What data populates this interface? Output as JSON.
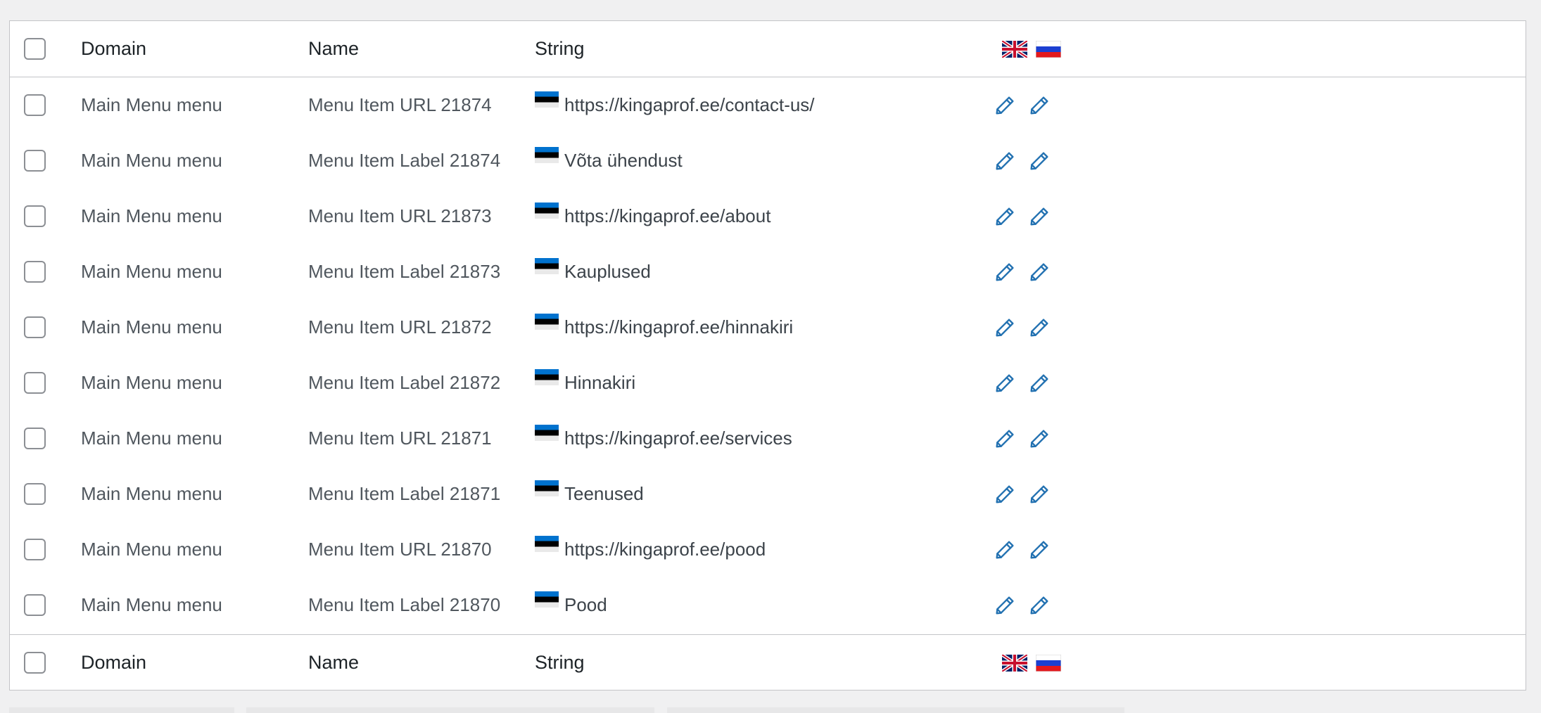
{
  "columns": {
    "domain": "Domain",
    "name": "Name",
    "string": "String"
  },
  "language_flags": [
    "uk-flag-icon",
    "ru-flag-icon"
  ],
  "string_flag": "ee-flag-icon",
  "rows": [
    {
      "domain": "Main Menu menu",
      "name": "Menu Item URL 21874",
      "string": "https://kingaprof.ee/contact-us/"
    },
    {
      "domain": "Main Menu menu",
      "name": "Menu Item Label 21874",
      "string": "Võta ühendust"
    },
    {
      "domain": "Main Menu menu",
      "name": "Menu Item URL 21873",
      "string": "https://kingaprof.ee/about"
    },
    {
      "domain": "Main Menu menu",
      "name": "Menu Item Label 21873",
      "string": "Kauplused"
    },
    {
      "domain": "Main Menu menu",
      "name": "Menu Item URL 21872",
      "string": "https://kingaprof.ee/hinnakiri"
    },
    {
      "domain": "Main Menu menu",
      "name": "Menu Item Label 21872",
      "string": "Hinnakiri"
    },
    {
      "domain": "Main Menu menu",
      "name": "Menu Item URL 21871",
      "string": "https://kingaprof.ee/services"
    },
    {
      "domain": "Main Menu menu",
      "name": "Menu Item Label 21871",
      "string": "Teenused"
    },
    {
      "domain": "Main Menu menu",
      "name": "Menu Item URL 21870",
      "string": "https://kingaprof.ee/pood"
    },
    {
      "domain": "Main Menu menu",
      "name": "Menu Item Label 21870",
      "string": "Pood"
    }
  ],
  "colors": {
    "accent": "#2271b1",
    "border": "#c3c4c7",
    "background": "#f0f0f1"
  }
}
